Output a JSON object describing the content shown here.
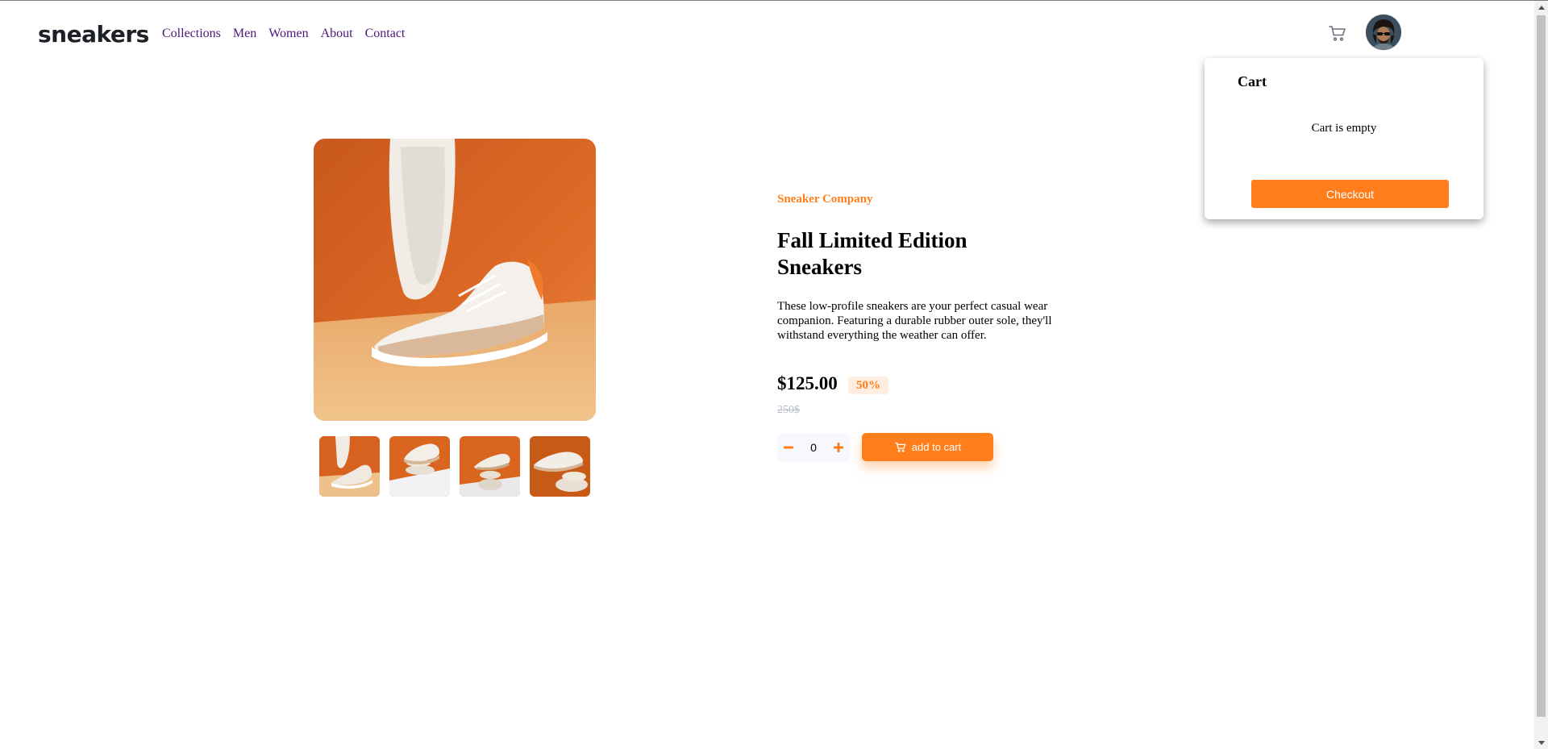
{
  "header": {
    "logo": "sneakers",
    "nav": [
      "Collections",
      "Men",
      "Women",
      "About",
      "Contact"
    ]
  },
  "product": {
    "company": "Sneaker Company",
    "title": "Fall Limited Edition Sneakers",
    "description": "These low-profile sneakers are your perfect casual wear companion. Featuring a durable rubber outer sole, they'll withstand everything the weather can offer.",
    "price": "$125.00",
    "discount": "50%",
    "old_price": "250$",
    "quantity": "0",
    "add_to_cart_label": "add to cart"
  },
  "cart": {
    "title": "Cart",
    "empty_message": "Cart is empty",
    "checkout_label": "Checkout"
  },
  "colors": {
    "accent": "#ff7d1a",
    "accent_pale": "#ffede0",
    "nav_link": "#4b1778",
    "old_price": "#b6bcc8"
  },
  "icons": {
    "header_cart": "cart-icon",
    "avatar": "user-avatar",
    "minus": "minus-icon",
    "plus": "plus-icon",
    "button_cart": "cart-icon"
  }
}
